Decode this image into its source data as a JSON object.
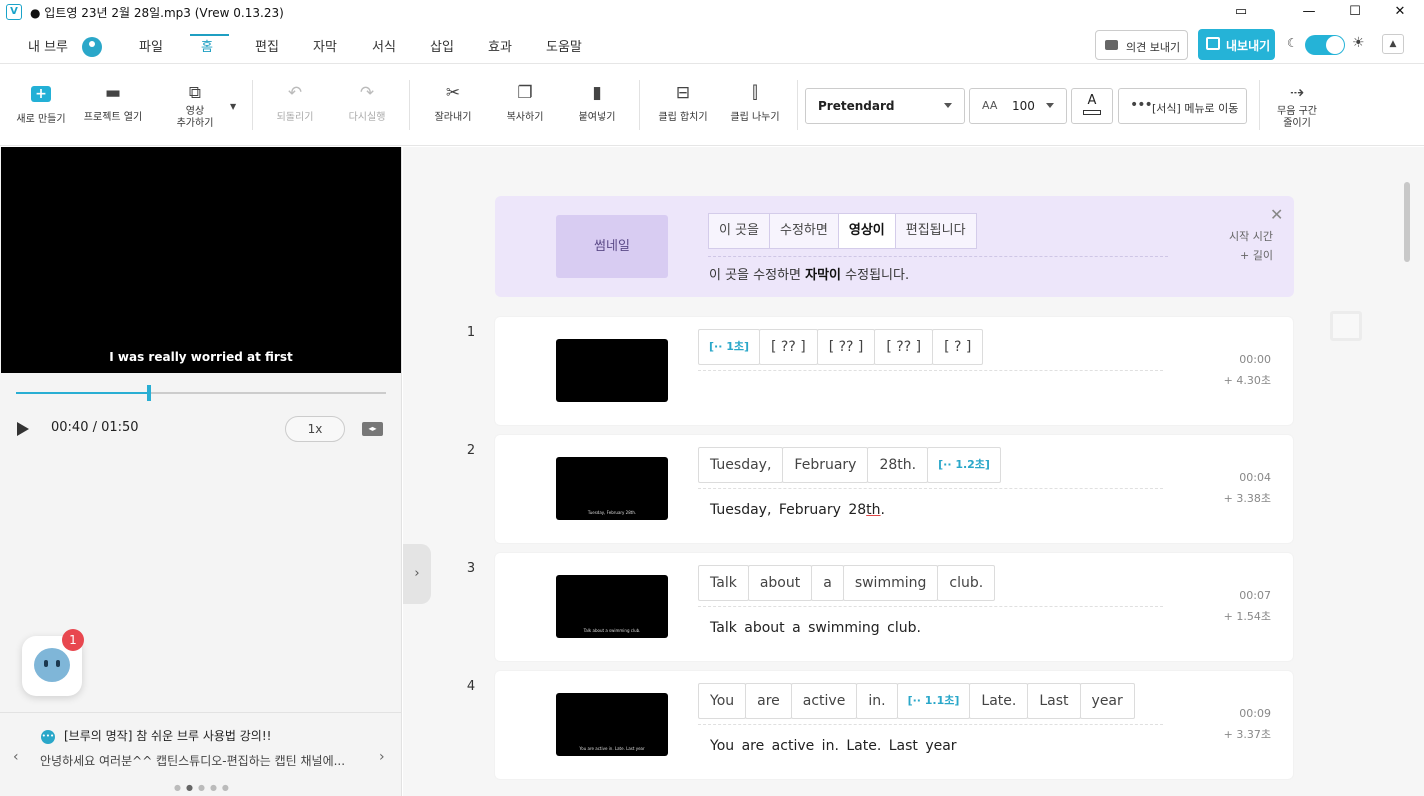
{
  "window": {
    "title": "● 입트영 23년 2월 28일.mp3 (Vrew 0.13.23)",
    "app_icon": "V",
    "controls": [
      "restore-icon",
      "minimize",
      "maximize",
      "close"
    ]
  },
  "menu": {
    "user_label": "내 브루",
    "items": [
      {
        "label": "파일"
      },
      {
        "label": "홈",
        "active": true
      },
      {
        "label": "편집"
      },
      {
        "label": "자막"
      },
      {
        "label": "서식"
      },
      {
        "label": "삽입"
      },
      {
        "label": "효과"
      },
      {
        "label": "도움말"
      }
    ],
    "feedback_label": "의견 보내기",
    "export_label": "내보내기",
    "accent": "#25b3d7"
  },
  "toolbar": {
    "new": "새로 만들기",
    "open_project": "프로젝트 열기",
    "add_video_1": "영상",
    "add_video_2": "추가하기",
    "undo": "되돌리기",
    "redo": "다시실행",
    "cut": "잘라내기",
    "copy": "복사하기",
    "paste": "붙여넣기",
    "merge": "클립 합치기",
    "split": "클립 나누기",
    "font": "Pretendard",
    "font_size": "100",
    "color_label": "A",
    "format_menu": "[서식] 메뉴로 이동",
    "silence_1": "무음 구간",
    "silence_2": "줄이기"
  },
  "player": {
    "overlay_subtitle": "I was really worried at first",
    "time": "00:40 / 01:50",
    "speed": "1x",
    "progress": 0.36
  },
  "chatbot": {
    "badge": "1"
  },
  "promo": {
    "title": "[브루의 명작] 참 쉬운 브루 사용법 강의!!",
    "body": "안녕하세요 여러분^^ 캡틴스튜디오-편집하는 캡틴 채널에..."
  },
  "guide": {
    "thumb_label": "썸네일",
    "tokens": [
      "이 곳을",
      "수정하면",
      "영상이",
      "편집됩니다"
    ],
    "text_before": "이  곳을  수정하면  ",
    "text_bold": "자막이",
    "text_after": "  수정됩니다.",
    "start_label": "시작 시간",
    "length_label": "+ 길이"
  },
  "clips": [
    {
      "num": "1",
      "thumb_caption": "",
      "words": [
        {
          "text": "[·· 1초]",
          "silence": true
        },
        {
          "text": "[ ?? ]"
        },
        {
          "text": "[ ?? ]"
        },
        {
          "text": "[ ?? ]"
        },
        {
          "text": "[ ? ]"
        }
      ],
      "subtitle": "",
      "time": "00:00",
      "length": "+  4.30초"
    },
    {
      "num": "2",
      "thumb_caption": "Tuesday, February 28th.",
      "words": [
        {
          "text": "Tuesday,"
        },
        {
          "text": "February"
        },
        {
          "text": "28th."
        },
        {
          "text": "[·· 1.2초]",
          "silence": true
        }
      ],
      "subtitle_pre": "Tuesday,  February  28",
      "subtitle_spell": "th",
      "subtitle_post": ".",
      "time": "00:04",
      "length": "+  3.38초"
    },
    {
      "num": "3",
      "thumb_caption": "Talk about a swimming club.",
      "words": [
        {
          "text": "Talk"
        },
        {
          "text": "about"
        },
        {
          "text": "a"
        },
        {
          "text": "swimming"
        },
        {
          "text": "club."
        }
      ],
      "subtitle": "Talk  about  a  swimming  club.",
      "time": "00:07",
      "length": "+  1.54초"
    },
    {
      "num": "4",
      "thumb_caption": "You are active in. Late. Last year",
      "words": [
        {
          "text": "You"
        },
        {
          "text": "are"
        },
        {
          "text": "active"
        },
        {
          "text": "in."
        },
        {
          "text": "[·· 1.1초]",
          "silence": true
        },
        {
          "text": "Late."
        },
        {
          "text": "Last"
        },
        {
          "text": "year"
        }
      ],
      "subtitle": "You  are  active  in.  Late.  Last  year",
      "time": "00:09",
      "length": "+  3.37초"
    }
  ]
}
